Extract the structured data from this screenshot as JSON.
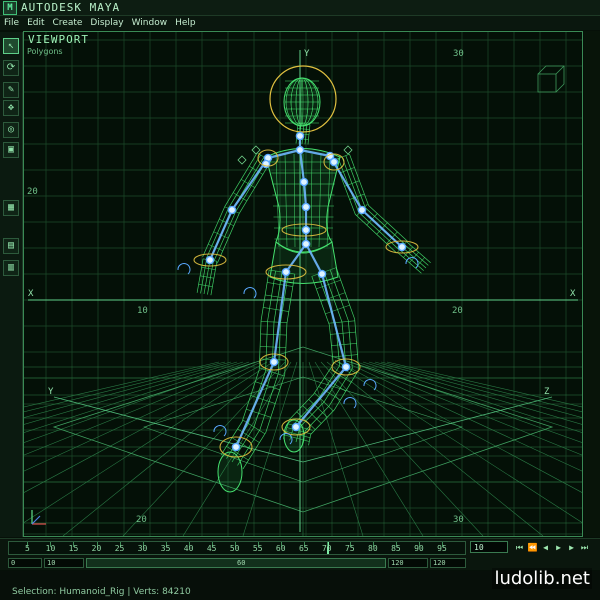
{
  "app": {
    "title": "AUTODESK MAYA",
    "logo_letter": "M",
    "accent": "#3fe07a"
  },
  "menu": [
    "File",
    "Edit",
    "Create",
    "Display",
    "Window",
    "Help"
  ],
  "toolbox": {
    "tools": [
      {
        "name": "select-tool",
        "icon": "arrow-icon",
        "glyph": "↖",
        "active": true
      },
      {
        "name": "lasso-tool",
        "icon": "lasso-icon",
        "glyph": "⟳",
        "active": false
      },
      {
        "name": "paint-tool",
        "icon": "brush-icon",
        "glyph": "✎",
        "active": false
      },
      {
        "name": "move-tool",
        "icon": "move-icon",
        "glyph": "✥",
        "active": false
      },
      {
        "name": "rotate-tool",
        "icon": "rotate-icon",
        "glyph": "◎",
        "active": false
      },
      {
        "name": "scale-tool",
        "icon": "scale-icon",
        "glyph": "▣",
        "active": false
      }
    ],
    "layouts": [
      {
        "name": "layout-single",
        "glyph": "▦"
      },
      {
        "name": "layout-two",
        "glyph": "▤"
      },
      {
        "name": "layout-four",
        "glyph": "▥"
      }
    ]
  },
  "viewport": {
    "label": "VIEWPORT",
    "sublabel": "Polygons",
    "axis_labels": {
      "x": "X",
      "y": "Y",
      "z": "Z"
    },
    "grid_labels": {
      "top": "30",
      "left": "20",
      "x10": "10",
      "x20": "20",
      "bottom": "20",
      "bottom_right": "30"
    }
  },
  "timeline": {
    "ticks": [
      "5",
      "10",
      "15",
      "20",
      "25",
      "30",
      "35",
      "40",
      "45",
      "50",
      "55",
      "60",
      "65",
      "70",
      "75",
      "80",
      "85",
      "90",
      "95"
    ],
    "min": 1,
    "max": 100,
    "current_frame": 70,
    "frame_field": "10"
  },
  "range": {
    "start": "0",
    "inner_start": "10",
    "slider_label": "60",
    "inner_end": "120",
    "end": "120"
  },
  "status": "Selection: Humanoid_Rig | Verts: 84210",
  "watermark": "ludolib.net"
}
